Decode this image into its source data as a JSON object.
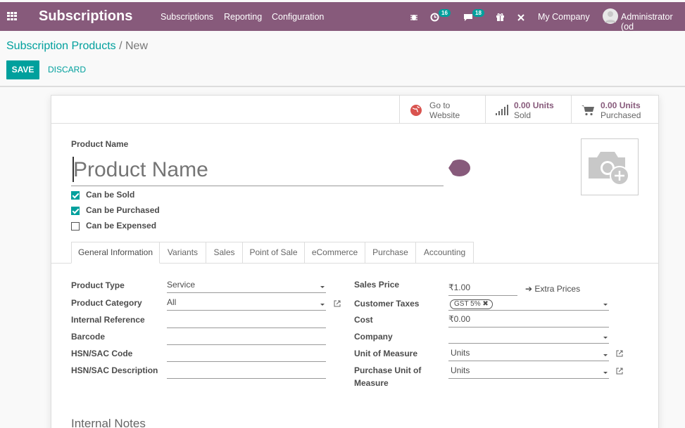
{
  "topbar": {
    "app_title": "Subscriptions",
    "menu": [
      "Subscriptions",
      "Reporting",
      "Configuration"
    ],
    "activity_count": "16",
    "messages_count": "18",
    "company": "My Company",
    "user": "Administrator (od",
    "icons": [
      "apps-grid-icon",
      "bug-icon",
      "activity-clock-icon",
      "chat-icon",
      "gift-icon",
      "tools-icon"
    ]
  },
  "breadcrumb": {
    "parent": "Subscription Products",
    "separator": "/",
    "current": "New"
  },
  "actions": {
    "save": "SAVE",
    "discard": "DISCARD"
  },
  "smart_buttons": [
    {
      "line1": "Go to",
      "line2": "Website",
      "icon": "globe-icon"
    },
    {
      "line1": "0.00 Units",
      "line2": "Sold",
      "icon": "bar-chart-icon"
    },
    {
      "line1": "0.00 Units",
      "line2": "Purchased",
      "icon": "cart-icon"
    }
  ],
  "product": {
    "label": "Product Name",
    "placeholder": "Product Name",
    "checkboxes": [
      {
        "label": "Can be Sold",
        "checked": true
      },
      {
        "label": "Can be Purchased",
        "checked": true
      },
      {
        "label": "Can be Expensed",
        "checked": false
      }
    ]
  },
  "tabs": [
    "General Information",
    "Variants",
    "Sales",
    "Point of Sale",
    "eCommerce",
    "Purchase",
    "Accounting"
  ],
  "left_fields": [
    {
      "label": "Product Type",
      "value": "Service"
    },
    {
      "label": "Product Category",
      "value": "All"
    },
    {
      "label": "Internal Reference",
      "value": ""
    },
    {
      "label": "Barcode",
      "value": ""
    },
    {
      "label": "HSN/SAC Code",
      "value": ""
    },
    {
      "label": "HSN/SAC Description",
      "value": ""
    }
  ],
  "right_fields": [
    {
      "label": "Sales Price",
      "value": "₹1.00"
    },
    {
      "label": "Customer Taxes",
      "value": "GST 5%"
    },
    {
      "label": "Cost",
      "value": "₹0.00"
    },
    {
      "label": "Company",
      "value": ""
    },
    {
      "label": "Unit of Measure",
      "value": "Units"
    },
    {
      "label": "Purchase Unit of",
      "label2": "Measure",
      "value": "Units"
    }
  ],
  "extra_prices": "Extra Prices",
  "internal_notes": "Internal Notes",
  "colors": {
    "brand": "#875a7b",
    "accent": "#00a09d"
  }
}
